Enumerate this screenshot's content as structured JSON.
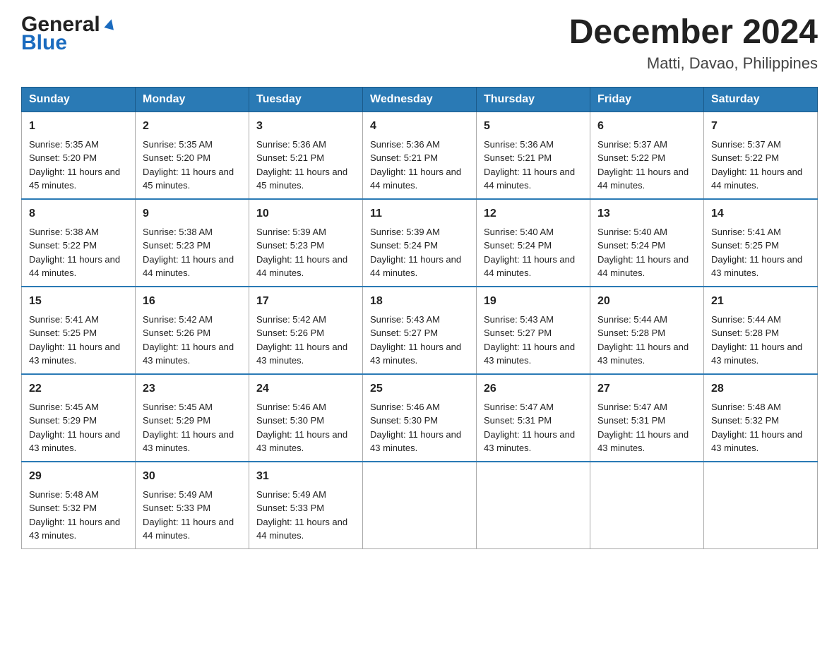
{
  "header": {
    "logo": {
      "general": "General",
      "blue": "Blue"
    },
    "title": "December 2024",
    "location": "Matti, Davao, Philippines"
  },
  "weekdays": [
    "Sunday",
    "Monday",
    "Tuesday",
    "Wednesday",
    "Thursday",
    "Friday",
    "Saturday"
  ],
  "weeks": [
    [
      {
        "day": "1",
        "sunrise": "5:35 AM",
        "sunset": "5:20 PM",
        "daylight": "11 hours and 45 minutes."
      },
      {
        "day": "2",
        "sunrise": "5:35 AM",
        "sunset": "5:20 PM",
        "daylight": "11 hours and 45 minutes."
      },
      {
        "day": "3",
        "sunrise": "5:36 AM",
        "sunset": "5:21 PM",
        "daylight": "11 hours and 45 minutes."
      },
      {
        "day": "4",
        "sunrise": "5:36 AM",
        "sunset": "5:21 PM",
        "daylight": "11 hours and 44 minutes."
      },
      {
        "day": "5",
        "sunrise": "5:36 AM",
        "sunset": "5:21 PM",
        "daylight": "11 hours and 44 minutes."
      },
      {
        "day": "6",
        "sunrise": "5:37 AM",
        "sunset": "5:22 PM",
        "daylight": "11 hours and 44 minutes."
      },
      {
        "day": "7",
        "sunrise": "5:37 AM",
        "sunset": "5:22 PM",
        "daylight": "11 hours and 44 minutes."
      }
    ],
    [
      {
        "day": "8",
        "sunrise": "5:38 AM",
        "sunset": "5:22 PM",
        "daylight": "11 hours and 44 minutes."
      },
      {
        "day": "9",
        "sunrise": "5:38 AM",
        "sunset": "5:23 PM",
        "daylight": "11 hours and 44 minutes."
      },
      {
        "day": "10",
        "sunrise": "5:39 AM",
        "sunset": "5:23 PM",
        "daylight": "11 hours and 44 minutes."
      },
      {
        "day": "11",
        "sunrise": "5:39 AM",
        "sunset": "5:24 PM",
        "daylight": "11 hours and 44 minutes."
      },
      {
        "day": "12",
        "sunrise": "5:40 AM",
        "sunset": "5:24 PM",
        "daylight": "11 hours and 44 minutes."
      },
      {
        "day": "13",
        "sunrise": "5:40 AM",
        "sunset": "5:24 PM",
        "daylight": "11 hours and 44 minutes."
      },
      {
        "day": "14",
        "sunrise": "5:41 AM",
        "sunset": "5:25 PM",
        "daylight": "11 hours and 43 minutes."
      }
    ],
    [
      {
        "day": "15",
        "sunrise": "5:41 AM",
        "sunset": "5:25 PM",
        "daylight": "11 hours and 43 minutes."
      },
      {
        "day": "16",
        "sunrise": "5:42 AM",
        "sunset": "5:26 PM",
        "daylight": "11 hours and 43 minutes."
      },
      {
        "day": "17",
        "sunrise": "5:42 AM",
        "sunset": "5:26 PM",
        "daylight": "11 hours and 43 minutes."
      },
      {
        "day": "18",
        "sunrise": "5:43 AM",
        "sunset": "5:27 PM",
        "daylight": "11 hours and 43 minutes."
      },
      {
        "day": "19",
        "sunrise": "5:43 AM",
        "sunset": "5:27 PM",
        "daylight": "11 hours and 43 minutes."
      },
      {
        "day": "20",
        "sunrise": "5:44 AM",
        "sunset": "5:28 PM",
        "daylight": "11 hours and 43 minutes."
      },
      {
        "day": "21",
        "sunrise": "5:44 AM",
        "sunset": "5:28 PM",
        "daylight": "11 hours and 43 minutes."
      }
    ],
    [
      {
        "day": "22",
        "sunrise": "5:45 AM",
        "sunset": "5:29 PM",
        "daylight": "11 hours and 43 minutes."
      },
      {
        "day": "23",
        "sunrise": "5:45 AM",
        "sunset": "5:29 PM",
        "daylight": "11 hours and 43 minutes."
      },
      {
        "day": "24",
        "sunrise": "5:46 AM",
        "sunset": "5:30 PM",
        "daylight": "11 hours and 43 minutes."
      },
      {
        "day": "25",
        "sunrise": "5:46 AM",
        "sunset": "5:30 PM",
        "daylight": "11 hours and 43 minutes."
      },
      {
        "day": "26",
        "sunrise": "5:47 AM",
        "sunset": "5:31 PM",
        "daylight": "11 hours and 43 minutes."
      },
      {
        "day": "27",
        "sunrise": "5:47 AM",
        "sunset": "5:31 PM",
        "daylight": "11 hours and 43 minutes."
      },
      {
        "day": "28",
        "sunrise": "5:48 AM",
        "sunset": "5:32 PM",
        "daylight": "11 hours and 43 minutes."
      }
    ],
    [
      {
        "day": "29",
        "sunrise": "5:48 AM",
        "sunset": "5:32 PM",
        "daylight": "11 hours and 43 minutes."
      },
      {
        "day": "30",
        "sunrise": "5:49 AM",
        "sunset": "5:33 PM",
        "daylight": "11 hours and 44 minutes."
      },
      {
        "day": "31",
        "sunrise": "5:49 AM",
        "sunset": "5:33 PM",
        "daylight": "11 hours and 44 minutes."
      },
      null,
      null,
      null,
      null
    ]
  ],
  "labels": {
    "sunrise": "Sunrise:",
    "sunset": "Sunset:",
    "daylight": "Daylight:"
  }
}
